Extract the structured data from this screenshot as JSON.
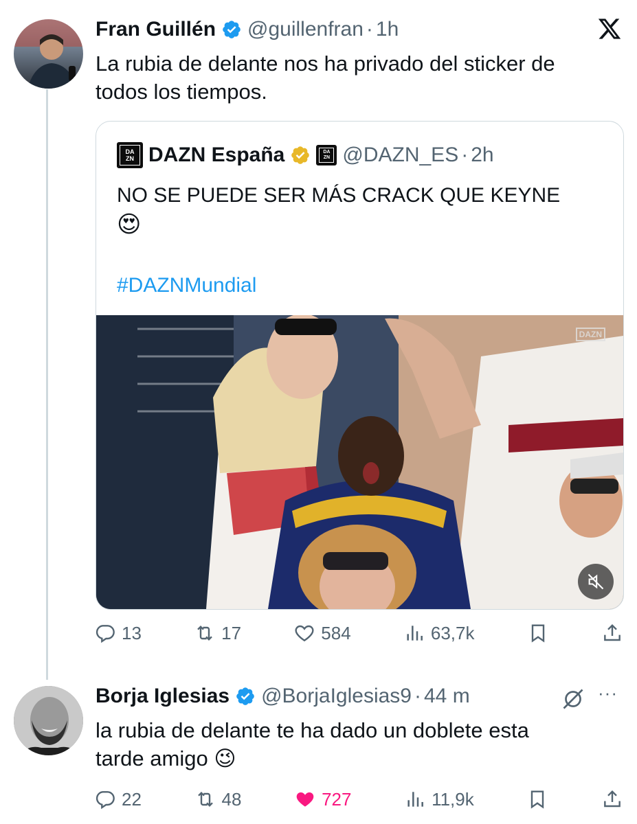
{
  "tweet": {
    "author_name": "Fran Guillén",
    "handle": "@guillenfran",
    "sep": "·",
    "time": "1h",
    "text_line1": "La rubia de delante nos ha privado del sticker de",
    "text_line2": "todos los tiempos.",
    "quote": {
      "author_name": "DAZN España",
      "logo_text_top": "DA",
      "logo_text_bottom": "ZN",
      "handle": "@DAZN_ES",
      "sep": "·",
      "time": "2h",
      "text": "NO SE PUEDE SER MÁS CRACK QUE KEYNE",
      "emoji": "😍",
      "hashtag": "#DAZNMundial",
      "media_watermark": "DAZN"
    },
    "actions": {
      "replies": "13",
      "reposts": "17",
      "likes": "584",
      "views": "63,7k"
    }
  },
  "reply": {
    "author_name": "Borja Iglesias",
    "handle": "@BorjaIglesias9",
    "sep": "·",
    "time": "44 m",
    "more": "···",
    "text_line1": "la rubia de delante te ha dado un doblete esta",
    "text_line2": "tarde amigo",
    "emoji": "😉",
    "actions": {
      "replies": "22",
      "reposts": "48",
      "likes": "727",
      "views": "11,9k"
    }
  },
  "colors": {
    "verified_blue": "#1d9bf0",
    "verified_gold": "#e8b829",
    "like_pink": "#f91880",
    "secondary": "#536471"
  },
  "icons": [
    "verified-icon",
    "x-logo-icon",
    "reply-icon",
    "repost-icon",
    "like-icon",
    "views-icon",
    "bookmark-icon",
    "share-icon",
    "mute-icon",
    "grok-icon",
    "more-icon"
  ]
}
